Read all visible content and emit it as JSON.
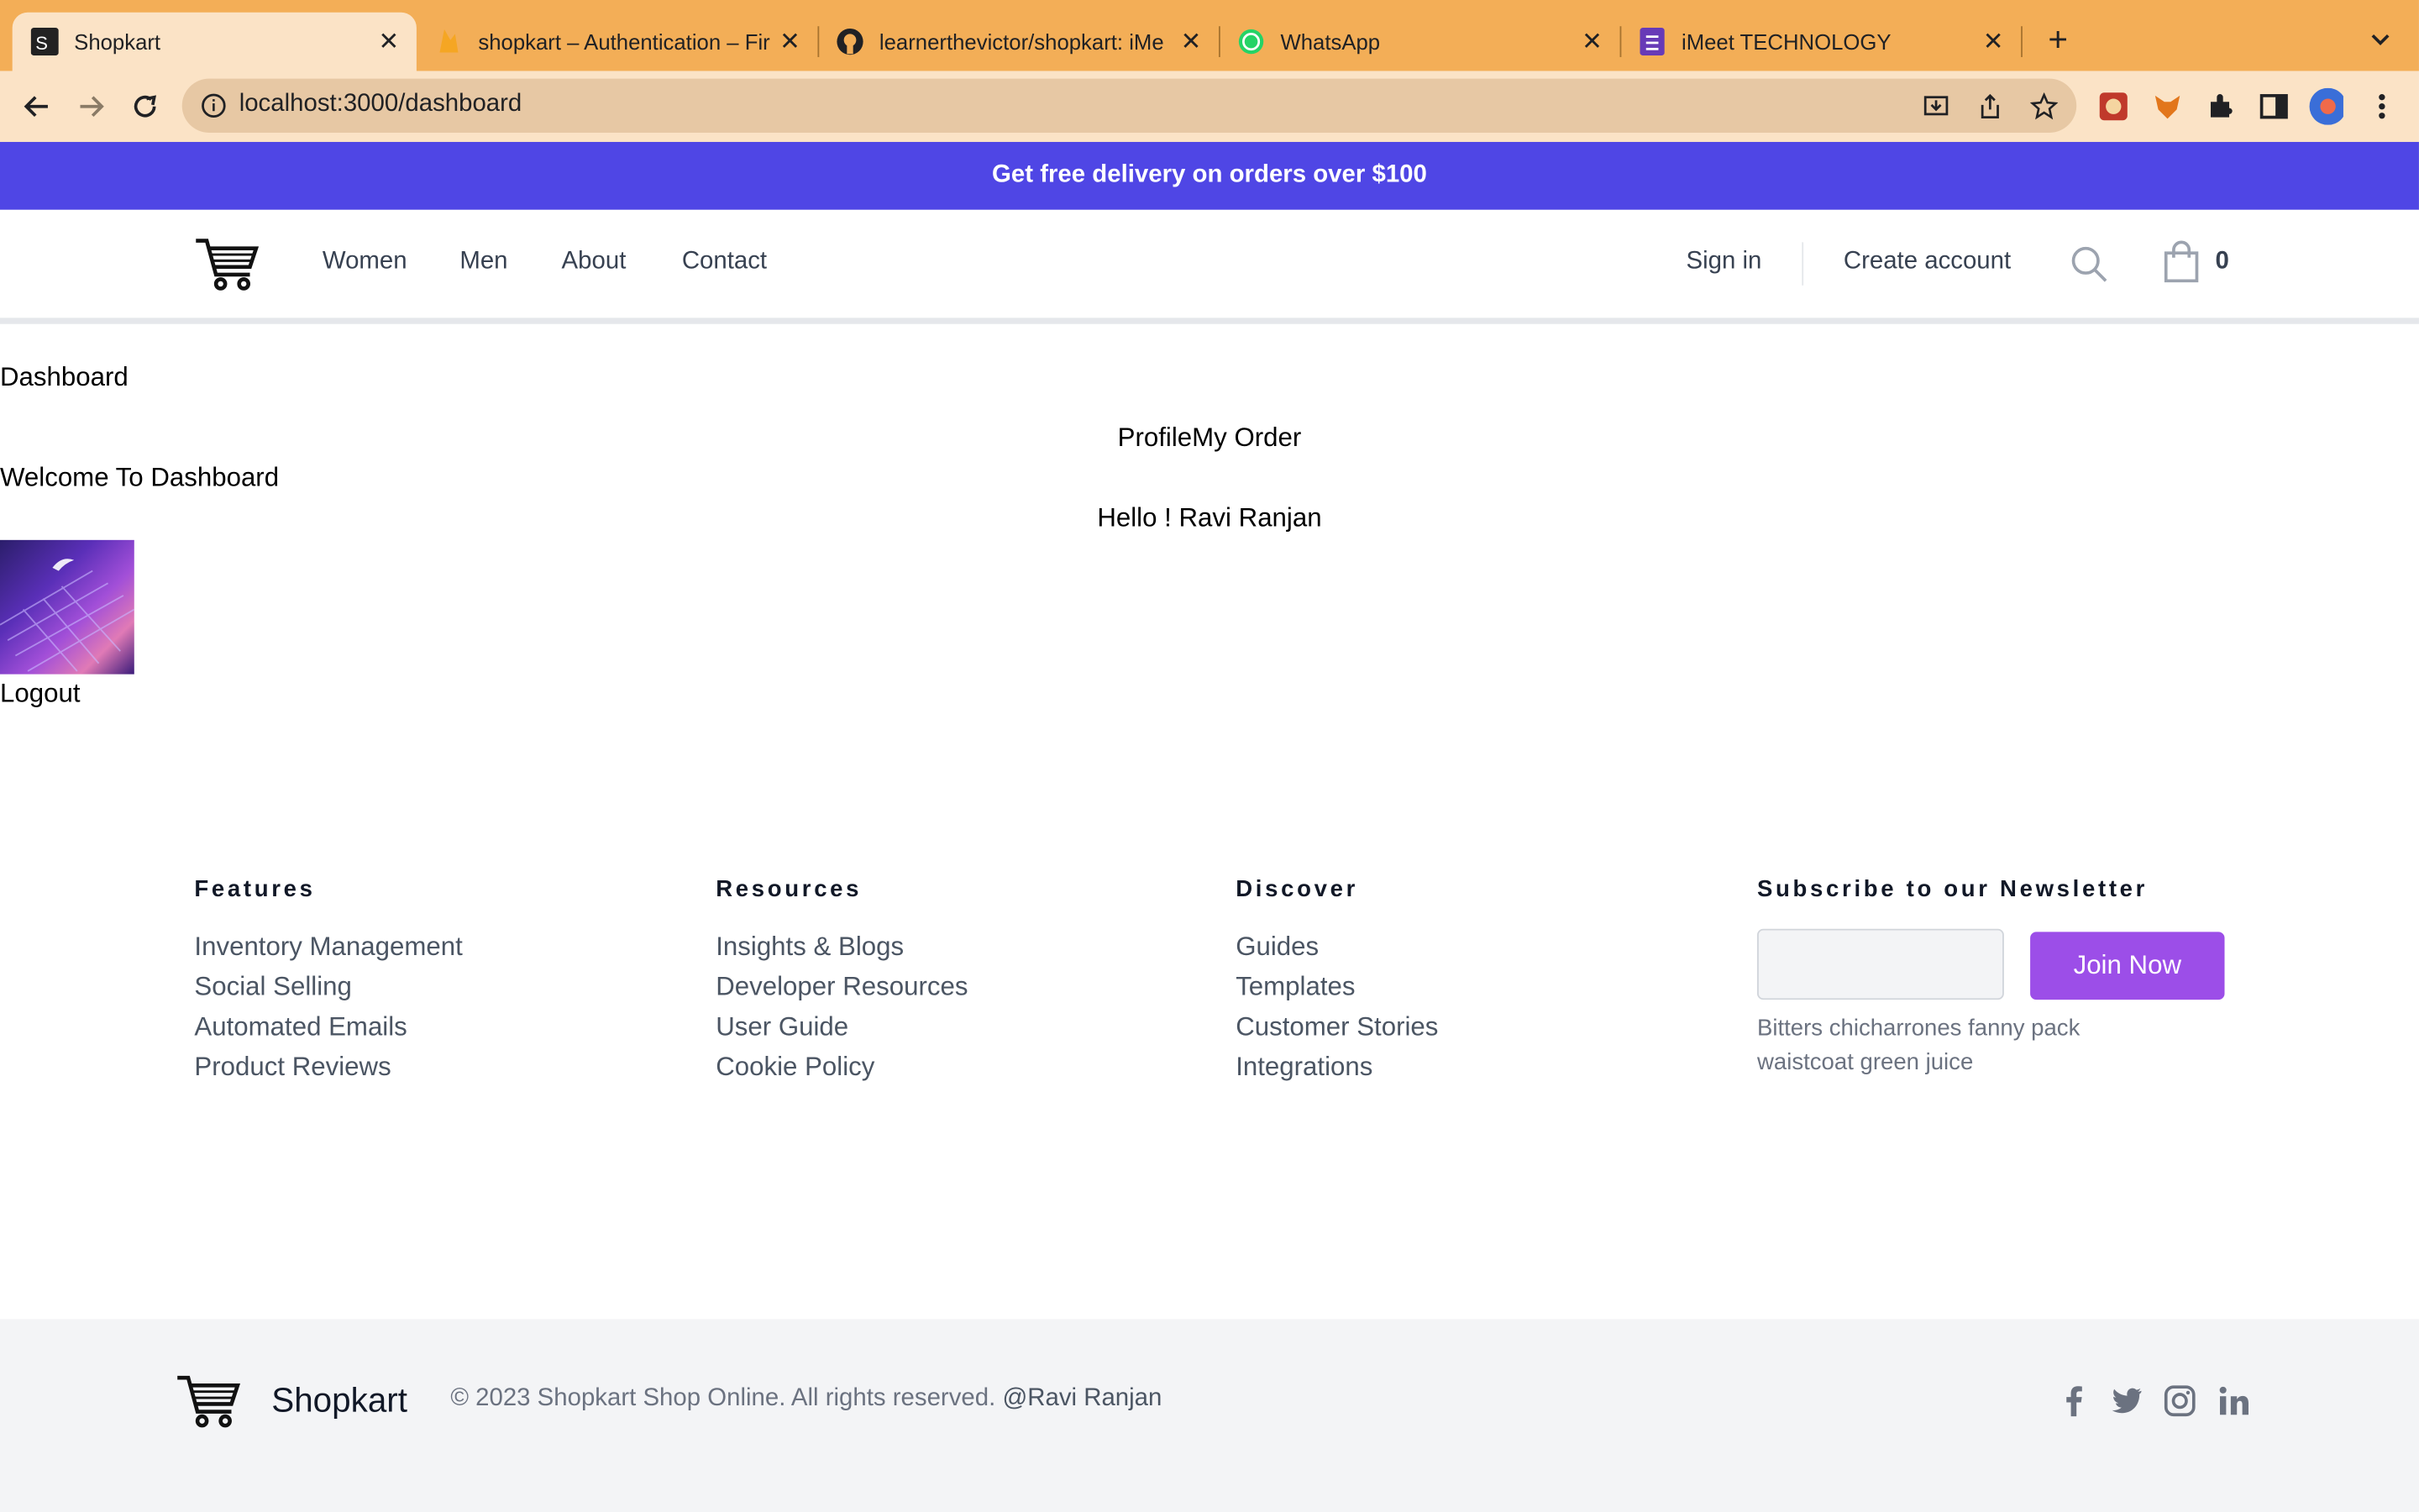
{
  "browser": {
    "tabs": [
      {
        "title": "Shopkart",
        "icon": "shopkart-favicon",
        "active": true
      },
      {
        "title": "shopkart – Authentication – Fir",
        "icon": "firebase-favicon"
      },
      {
        "title": "learnerthevictor/shopkart: iMe",
        "icon": "github-favicon"
      },
      {
        "title": "WhatsApp",
        "icon": "whatsapp-favicon"
      },
      {
        "title": "iMeet TECHNOLOGY",
        "icon": "forms-favicon"
      }
    ],
    "url": "localhost:3000/dashboard"
  },
  "colors": {
    "tabbar": "#f3ae57",
    "toolbar": "#fbe3c6",
    "banner": "#4f46e5",
    "join_button": "#9c4ee8"
  },
  "banner": {
    "text": "Get free delivery on orders over $100"
  },
  "header": {
    "nav": [
      "Women",
      "Men",
      "About",
      "Contact"
    ],
    "sign_in": "Sign in",
    "create_account": "Create account",
    "cart_count": "0"
  },
  "dashboard": {
    "title": "Dashboard",
    "welcome": "Welcome To Dashboard",
    "tabs": "ProfileMy Order",
    "greeting": "Hello ! Ravi Ranjan",
    "logout": "Logout"
  },
  "footer": {
    "columns": [
      {
        "heading": "Features",
        "links": [
          "Inventory Management",
          "Social Selling",
          "Automated Emails",
          "Product Reviews"
        ]
      },
      {
        "heading": "Resources",
        "links": [
          "Insights & Blogs",
          "Developer Resources",
          "User Guide",
          "Cookie Policy"
        ]
      },
      {
        "heading": "Discover",
        "links": [
          "Guides",
          "Templates",
          "Customer Stories",
          "Integrations"
        ]
      }
    ],
    "newsletter": {
      "heading": "Subscribe to our Newsletter",
      "button": "Join Now",
      "text": "Bitters chicharrones fanny pack waistcoat green juice"
    },
    "brand": "Shopkart",
    "copyright": "© 2023 Shopkart Shop Online. All rights reserved.",
    "handle": "@Ravi Ranjan"
  }
}
